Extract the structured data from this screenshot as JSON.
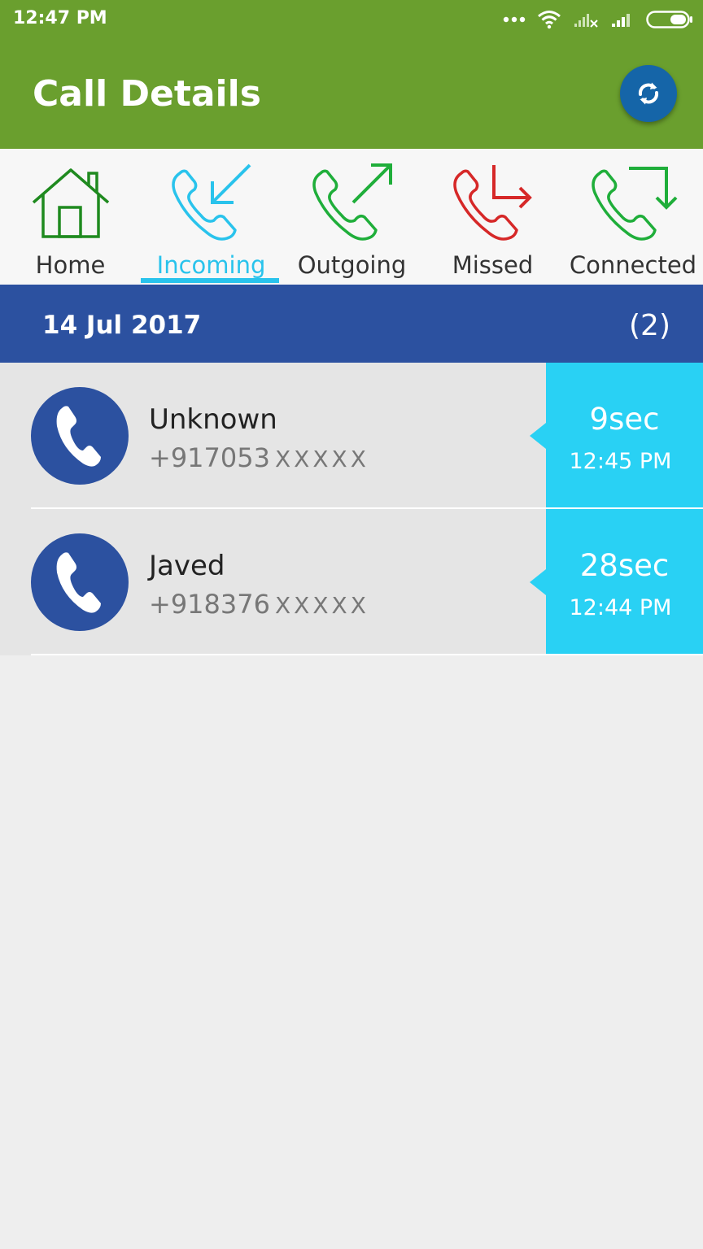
{
  "status_bar": {
    "time": "12:47 PM"
  },
  "toolbar": {
    "title": "Call Details"
  },
  "tabs": [
    {
      "label": "Home",
      "icon": "home-icon",
      "color": "#1f8a1f"
    },
    {
      "label": "Incoming",
      "icon": "incoming-call-icon",
      "color": "#29c3ec",
      "active": true
    },
    {
      "label": "Outgoing",
      "icon": "outgoing-call-icon",
      "color": "#1fae3a"
    },
    {
      "label": "Missed",
      "icon": "missed-call-icon",
      "color": "#d62828"
    },
    {
      "label": "Connected",
      "icon": "connected-call-icon",
      "color": "#1fae3a"
    }
  ],
  "date_group": {
    "date": "14 Jul 2017",
    "count": "(2)"
  },
  "calls": [
    {
      "name": "Unknown",
      "number": "+917053",
      "masked": "XXXXX",
      "duration": "9sec",
      "time": "12:45 PM"
    },
    {
      "name": "Javed",
      "number": "+918376",
      "masked": "XXXXX",
      "duration": "28sec",
      "time": "12:44 PM"
    }
  ],
  "colors": {
    "toolbar": "#6a9f2e",
    "accent": "#29c3ec",
    "date_header": "#2c51a0",
    "duration_panel": "#29d1f4",
    "refresh_button": "#1565a8"
  }
}
